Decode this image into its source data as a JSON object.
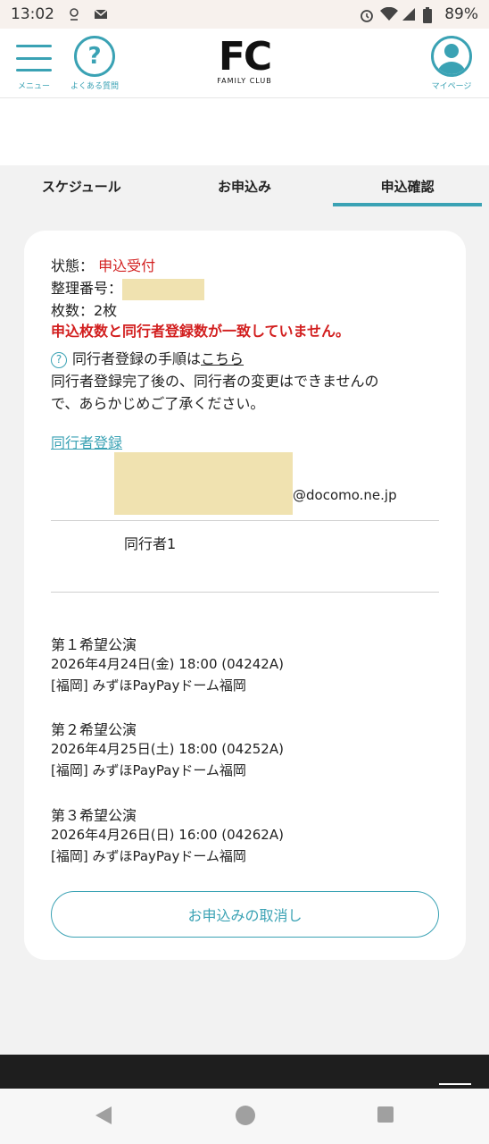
{
  "status_bar": {
    "time": "13:02",
    "battery": "89%"
  },
  "header": {
    "menu_label": "メニュー",
    "faq_label": "よくある質問",
    "logo_text": "FC",
    "logo_sub": "FAMILY CLUB",
    "mypage_label": "マイページ"
  },
  "tabs": [
    {
      "label": "スケジュール",
      "active": false
    },
    {
      "label": "お申込み",
      "active": false
    },
    {
      "label": "申込確認",
      "active": true
    }
  ],
  "application": {
    "status_label": "状態：",
    "status_value": "申込受付",
    "ticket_no_label": "整理番号：",
    "count_label": "枚数：2枚",
    "warning": "申込枚数と同行者登録数が一致していません。",
    "help_prefix": "同行者登録の手順は",
    "help_link": "こちら",
    "notice_line1": "同行者登録完了後の、同行者の変更はできませんの",
    "notice_line2": "で、あらかじめご了承ください。",
    "companion_link": "同行者登録",
    "email_suffix": "@docomo.ne.jp",
    "companion_1": "同行者1"
  },
  "choices": [
    {
      "title": "第１希望公演",
      "datetime": "2026年4月24日(金) 18:00 (04242A)",
      "venue": "[福岡] みずほPayPayドーム福岡"
    },
    {
      "title": "第２希望公演",
      "datetime": "2026年4月25日(土) 18:00 (04252A)",
      "venue": "[福岡] みずほPayPayドーム福岡"
    },
    {
      "title": "第３希望公演",
      "datetime": "2026年4月26日(日) 16:00 (04262A)",
      "venue": "[福岡] みずほPayPayドーム福岡"
    }
  ],
  "cancel_button": "お申込みの取消し",
  "colors": {
    "accent": "#3aa2b4",
    "warning": "#d21f1f",
    "mask": "#f0e2b0"
  }
}
